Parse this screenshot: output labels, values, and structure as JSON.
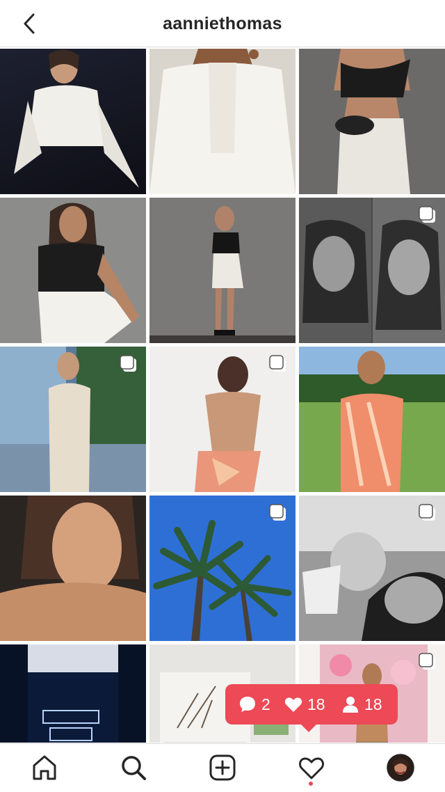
{
  "header": {
    "username": "aanniethomas",
    "back_icon": "chevron-left-icon"
  },
  "grid": {
    "columns": 3,
    "posts": [
      {
        "label": "white-top-dark-wall",
        "multi": false
      },
      {
        "label": "white-jacket-mirror",
        "multi": false
      },
      {
        "label": "black-top-satin-skirt",
        "multi": false
      },
      {
        "label": "black-top-holding-skirt",
        "multi": false
      },
      {
        "label": "full-length-grey-wall",
        "multi": false
      },
      {
        "label": "black-and-white-selfies",
        "multi": true
      },
      {
        "label": "cream-dress-deck",
        "multi": true
      },
      {
        "label": "floral-dress-back",
        "multi": true
      },
      {
        "label": "floral-dress-garden",
        "multi": false
      },
      {
        "label": "close-up-portrait",
        "multi": false
      },
      {
        "label": "palm-tree-sky",
        "multi": true
      },
      {
        "label": "baby-black-and-white",
        "multi": true
      },
      {
        "label": "neon-sign-room",
        "multi": false
      },
      {
        "label": "living-room-interior",
        "multi": false
      },
      {
        "label": "flower-wall",
        "multi": true
      }
    ]
  },
  "activity_bubble": {
    "comments": "2",
    "likes": "18",
    "follows": "18",
    "color": "#ed4956"
  },
  "bottom_nav": {
    "items": [
      "home-icon",
      "search-icon",
      "new-post-icon",
      "activity-heart-icon",
      "profile-avatar"
    ],
    "active": "search-icon",
    "notification_dot_color": "#ed4956"
  }
}
